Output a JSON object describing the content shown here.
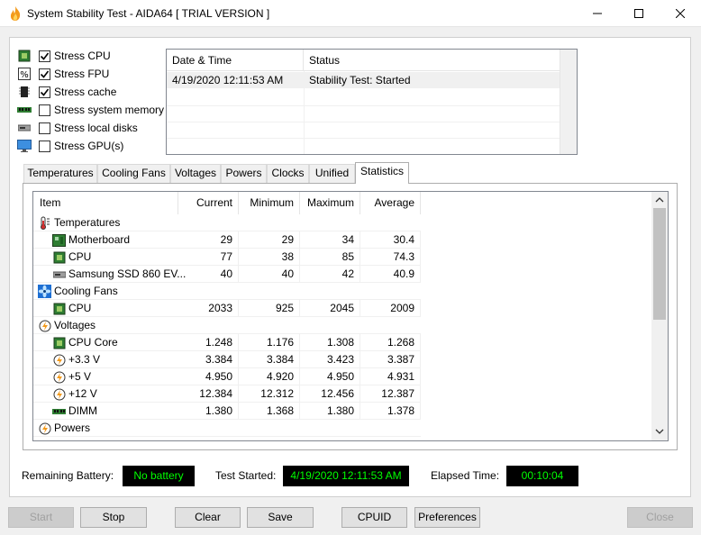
{
  "window": {
    "title": "System Stability Test - AIDA64  [ TRIAL VERSION ]"
  },
  "stress": [
    {
      "label": "Stress CPU",
      "checked": true,
      "icon": "cpu-chip-icon"
    },
    {
      "label": "Stress FPU",
      "checked": true,
      "icon": "fpu-percent-icon"
    },
    {
      "label": "Stress cache",
      "checked": true,
      "icon": "cache-chip-icon"
    },
    {
      "label": "Stress system memory",
      "checked": false,
      "icon": "memory-module-icon"
    },
    {
      "label": "Stress local disks",
      "checked": false,
      "icon": "disk-drive-icon"
    },
    {
      "label": "Stress GPU(s)",
      "checked": false,
      "icon": "monitor-icon"
    }
  ],
  "log": {
    "headers": [
      "Date & Time",
      "Status"
    ],
    "rows": [
      {
        "datetime": "4/19/2020 12:11:53 AM",
        "status": "Stability Test: Started"
      }
    ]
  },
  "tabs": [
    "Temperatures",
    "Cooling Fans",
    "Voltages",
    "Powers",
    "Clocks",
    "Unified",
    "Statistics"
  ],
  "active_tab": "Statistics",
  "stats": {
    "headers": {
      "item": "Item",
      "current": "Current",
      "minimum": "Minimum",
      "maximum": "Maximum",
      "average": "Average"
    },
    "rows": [
      {
        "group": true,
        "label": "Temperatures",
        "icon": "thermometer-icon"
      },
      {
        "label": "Motherboard",
        "icon": "motherboard-icon",
        "current": "29",
        "minimum": "29",
        "maximum": "34",
        "average": "30.4"
      },
      {
        "label": "CPU",
        "icon": "cpu-chip-icon",
        "current": "77",
        "minimum": "38",
        "maximum": "85",
        "average": "74.3"
      },
      {
        "label": "Samsung SSD 860 EV...",
        "icon": "ssd-drive-icon",
        "current": "40",
        "minimum": "40",
        "maximum": "42",
        "average": "40.9"
      },
      {
        "group": true,
        "label": "Cooling Fans",
        "icon": "fan-icon"
      },
      {
        "label": "CPU",
        "icon": "cpu-chip-icon",
        "current": "2033",
        "minimum": "925",
        "maximum": "2045",
        "average": "2009"
      },
      {
        "group": true,
        "label": "Voltages",
        "icon": "lightning-icon"
      },
      {
        "label": "CPU Core",
        "icon": "cpu-chip-icon",
        "current": "1.248",
        "minimum": "1.176",
        "maximum": "1.308",
        "average": "1.268"
      },
      {
        "label": "+3.3 V",
        "icon": "lightning-icon",
        "current": "3.384",
        "minimum": "3.384",
        "maximum": "3.423",
        "average": "3.387"
      },
      {
        "label": "+5 V",
        "icon": "lightning-icon",
        "current": "4.950",
        "minimum": "4.920",
        "maximum": "4.950",
        "average": "4.931"
      },
      {
        "label": "+12 V",
        "icon": "lightning-icon",
        "current": "12.384",
        "minimum": "12.312",
        "maximum": "12.456",
        "average": "12.387"
      },
      {
        "label": "DIMM",
        "icon": "memory-module-icon",
        "current": "1.380",
        "minimum": "1.368",
        "maximum": "1.380",
        "average": "1.378"
      },
      {
        "group": true,
        "label": "Powers",
        "icon": "lightning-icon"
      }
    ]
  },
  "status_bar": {
    "battery_label": "Remaining Battery:",
    "battery_value": "No battery",
    "started_label": "Test Started:",
    "started_value": "4/19/2020 12:11:53 AM",
    "elapsed_label": "Elapsed Time:",
    "elapsed_value": "00:10:04"
  },
  "buttons": {
    "start": "Start",
    "stop": "Stop",
    "clear": "Clear",
    "save": "Save",
    "cpuid": "CPUID",
    "preferences": "Preferences",
    "close": "Close"
  },
  "colors": {
    "lcd_bg": "#000000",
    "lcd_text": "#00ff00",
    "accent_blue": "#1d6fd3"
  }
}
